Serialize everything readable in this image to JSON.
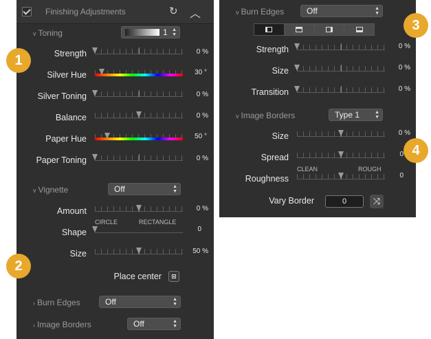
{
  "left": {
    "header": {
      "title": "Finishing Adjustments"
    },
    "toning": {
      "label": "Toning",
      "select_value": "1",
      "strength": {
        "label": "Strength",
        "value": "0 %",
        "level": 0
      },
      "silver_hue": {
        "label": "Silver Hue",
        "value": "30 °",
        "level": 0.08
      },
      "silver_toning": {
        "label": "Silver Toning",
        "value": "0 %",
        "level": 0
      },
      "balance": {
        "label": "Balance",
        "value": "0 %",
        "level": 0.5
      },
      "paper_hue": {
        "label": "Paper Hue",
        "value": "50 °",
        "level": 0.14
      },
      "paper_toning": {
        "label": "Paper Toning",
        "value": "0 %",
        "level": 0
      }
    },
    "vignette": {
      "label": "Vignette",
      "select_value": "Off",
      "amount": {
        "label": "Amount",
        "value": "0 %",
        "level": 0.5
      },
      "shape": {
        "label": "Shape",
        "value": "0",
        "left_label": "CIRCLE",
        "right_label": "RECTANGLE",
        "level": 0
      },
      "size": {
        "label": "Size",
        "value": "50 %",
        "level": 0.5
      },
      "place_center": "Place center"
    },
    "burn_edges": {
      "label": "Burn Edges",
      "select_value": "Off"
    },
    "image_borders": {
      "label": "Image Borders",
      "select_value": "Off"
    }
  },
  "right": {
    "burn_edges": {
      "label": "Burn Edges",
      "select_value": "Off",
      "strength": {
        "label": "Strength",
        "value": "0 %",
        "level": 0
      },
      "size": {
        "label": "Size",
        "value": "0 %",
        "level": 0
      },
      "transition": {
        "label": "Transition",
        "value": "0 %",
        "level": 0
      }
    },
    "image_borders": {
      "label": "Image Borders",
      "select_value": "Type 1",
      "size": {
        "label": "Size",
        "value": "0 %",
        "level": 0.5
      },
      "spread": {
        "label": "Spread",
        "value": "0",
        "level": 0.5
      },
      "roughness": {
        "label": "Roughness",
        "value": "0",
        "left_label": "CLEAN",
        "right_label": "ROUGH",
        "level": 0.5
      },
      "vary_border": {
        "label": "Vary Border",
        "value": "0"
      }
    }
  },
  "badges": [
    "1",
    "2",
    "3",
    "4"
  ],
  "colors": {
    "panel": "#2f2f2f",
    "badge": "#e8a82c"
  }
}
